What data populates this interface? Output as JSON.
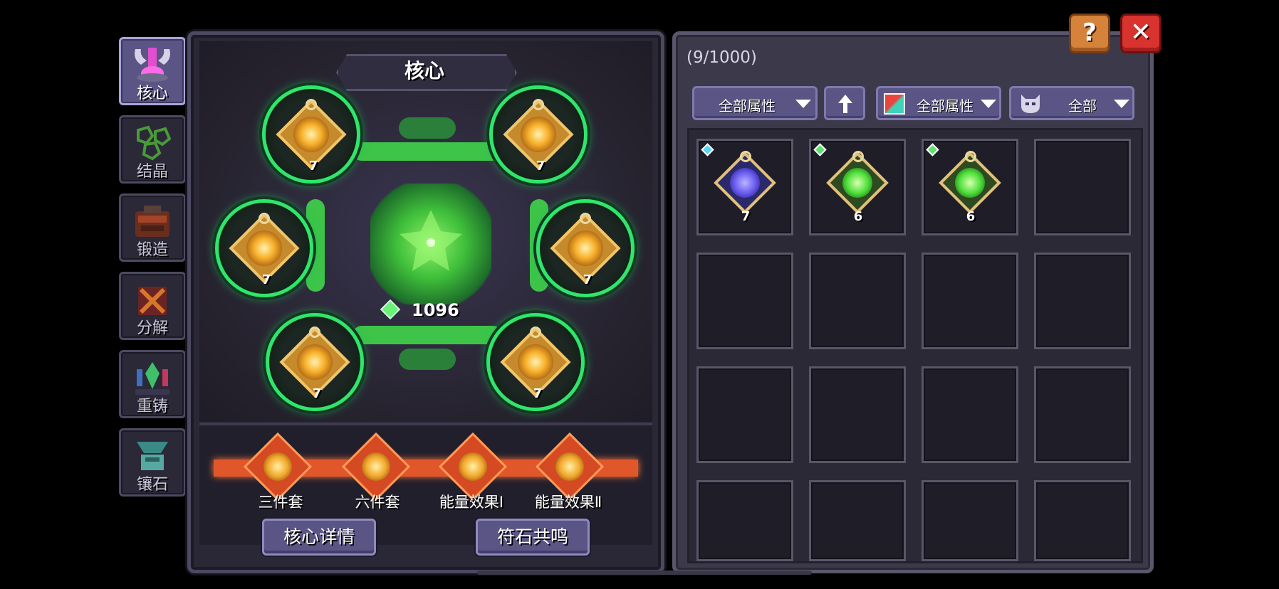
{
  "tabs": [
    {
      "label": "核心",
      "icon": "core-icon",
      "active": true
    },
    {
      "label": "结晶",
      "icon": "crystal-icon",
      "active": false
    },
    {
      "label": "锻造",
      "icon": "forge-icon",
      "active": false
    },
    {
      "label": "分解",
      "icon": "dismantle-icon",
      "active": false
    },
    {
      "label": "重铸",
      "icon": "recast-icon",
      "active": false
    },
    {
      "label": "镶石",
      "icon": "inlay-icon",
      "active": false
    }
  ],
  "core": {
    "title": "核心",
    "energy": "1096",
    "slots": [
      {
        "level": "7"
      },
      {
        "level": "7"
      },
      {
        "level": "7"
      },
      {
        "level": "7"
      },
      {
        "level": "7"
      },
      {
        "level": "7"
      }
    ],
    "sets": [
      "三件套",
      "六件套",
      "能量效果Ⅰ",
      "能量效果Ⅱ"
    ],
    "buttons": {
      "details": "核心详情",
      "resonance": "符石共鸣"
    }
  },
  "inventory": {
    "count": "(9/1000)",
    "filters": {
      "attribute": "全部属性",
      "color_attribute": "全部属性",
      "type": "全部"
    },
    "items": [
      {
        "level": "7",
        "color": "#6a5cf0",
        "badge": "#5fd3f5"
      },
      {
        "level": "6",
        "color": "#4fe03a",
        "badge": "#5ee36e"
      },
      {
        "level": "6",
        "color": "#4fe03a",
        "badge": "#5ee36e"
      }
    ]
  },
  "colors": {
    "slot_ring": "#2ee66b",
    "set_band": "#e1562a",
    "button": "#5b5585",
    "help": "#d5823a",
    "close": "#d8332f"
  },
  "controls": {
    "help": "?",
    "close": "✕"
  }
}
